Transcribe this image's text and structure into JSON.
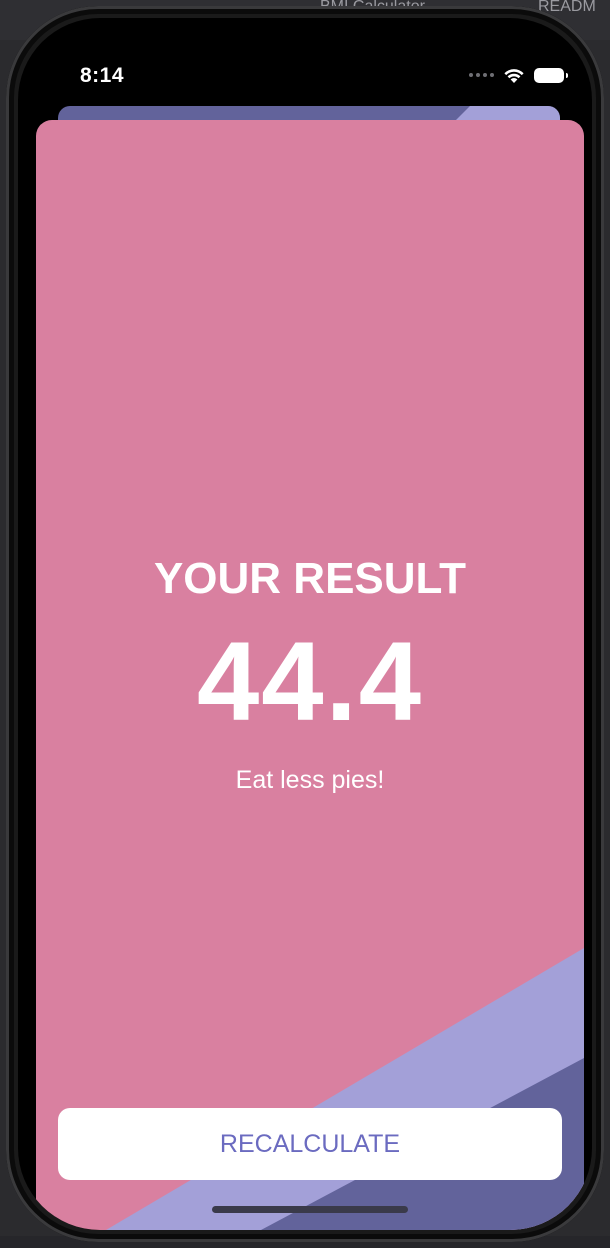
{
  "desktop": {
    "tab_left": "BMI Calculator",
    "tab_right": "READM"
  },
  "status_bar": {
    "time": "8:14",
    "icons": [
      "signal-dots-icon",
      "wifi-icon",
      "battery-icon"
    ]
  },
  "result": {
    "title": "YOUR RESULT",
    "value": "44.4",
    "advice": "Eat less pies!"
  },
  "actions": {
    "recalculate_label": "RECALCULATE"
  },
  "colors": {
    "sheet_background": "#d980a0",
    "stripe_light": "#a3a0d8",
    "stripe_dark": "#62639b",
    "button_text": "#6b6bc0",
    "button_background": "#ffffff"
  }
}
